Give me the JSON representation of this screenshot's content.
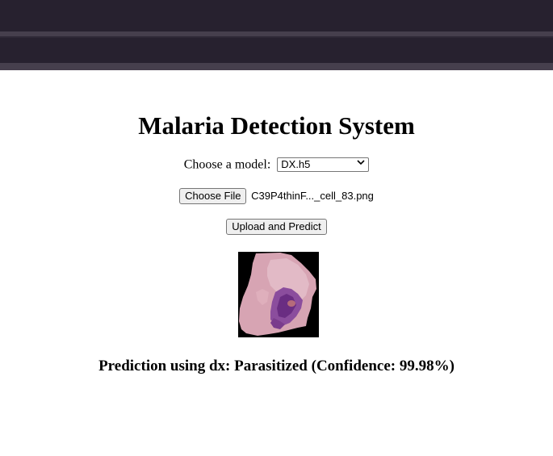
{
  "header": {
    "colors": {
      "bar": "#27212f",
      "stripe": "#463f4d"
    }
  },
  "page": {
    "title": "Malaria Detection System",
    "model_label": "Choose a model:",
    "model_selected": "DX.h5",
    "choose_file_label": "Choose File",
    "file_name": "C39P4thinF..._cell_83.png",
    "upload_label": "Upload and Predict",
    "result_text": "Prediction using dx: Parasitized (Confidence: 99.98%)"
  },
  "preview_image": {
    "icon": "blood-cell-image"
  }
}
